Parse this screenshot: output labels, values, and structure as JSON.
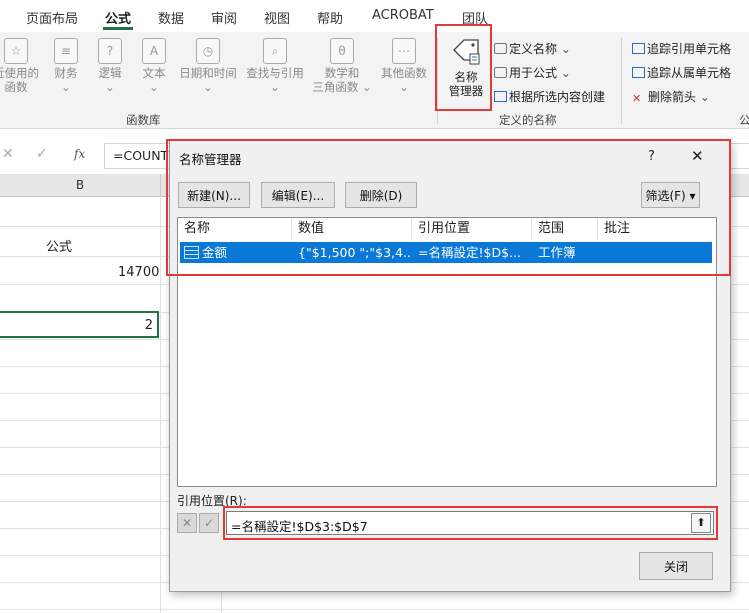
{
  "tabs": [
    "页面布局",
    "公式",
    "数据",
    "审阅",
    "视图",
    "帮助",
    "ACROBAT",
    "团队"
  ],
  "active_tab": "公式",
  "ribbon": {
    "library_buttons": [
      {
        "label1": "近使用的",
        "label2": "函数",
        "icon": "star-icon"
      },
      {
        "label1": "财务",
        "label2": "",
        "icon": "database-icon"
      },
      {
        "label1": "逻辑",
        "label2": "",
        "icon": "question-icon"
      },
      {
        "label1": "文本",
        "label2": "",
        "icon": "text-a-icon"
      },
      {
        "label1": "日期和时间",
        "label2": "",
        "icon": "clock-icon"
      },
      {
        "label1": "查找与引用",
        "label2": "",
        "icon": "magnifier-icon"
      },
      {
        "label1": "数学和",
        "label2": "三角函数",
        "icon": "theta-icon"
      },
      {
        "label1": "其他函数",
        "label2": "",
        "icon": "more-icon"
      }
    ],
    "library_group_label": "函数库",
    "name_manager_label1": "名称",
    "name_manager_label2": "管理器",
    "define_name": "定义名称",
    "use_in_formula": "用于公式",
    "create_from_selection": "根据所选内容创建",
    "defined_names_group_label": "定义的名称",
    "trace_precedents": "追踪引用单元格",
    "trace_dependents": "追踪从属单元格",
    "remove_arrows": "删除箭头",
    "audit_group_label_partial": "公"
  },
  "formula_bar": {
    "fx": "fx",
    "content": "=COUNT"
  },
  "sheet": {
    "col_b": "B",
    "header_cell": "公式",
    "value1": "14700",
    "value2": "2"
  },
  "dialog": {
    "title": "名称管理器",
    "help": "?",
    "close_x": "✕",
    "new_btn": "新建(N)...",
    "edit_btn": "编辑(E)...",
    "delete_btn": "删除(D)",
    "filter_btn": "筛选(F) ▾",
    "columns": [
      "名称",
      "数值",
      "引用位置",
      "范围",
      "批注"
    ],
    "rows": [
      {
        "name": "金额",
        "value": "{\"$1,500 \";\"$3,4...",
        "refers_to": "=名稱設定!$D$...",
        "scope": "工作簿",
        "comment": ""
      }
    ],
    "refers_to_label": "引用位置(R):",
    "refers_to_value": "=名稱設定!$D$3:$D$7",
    "close_btn": "关闭"
  }
}
